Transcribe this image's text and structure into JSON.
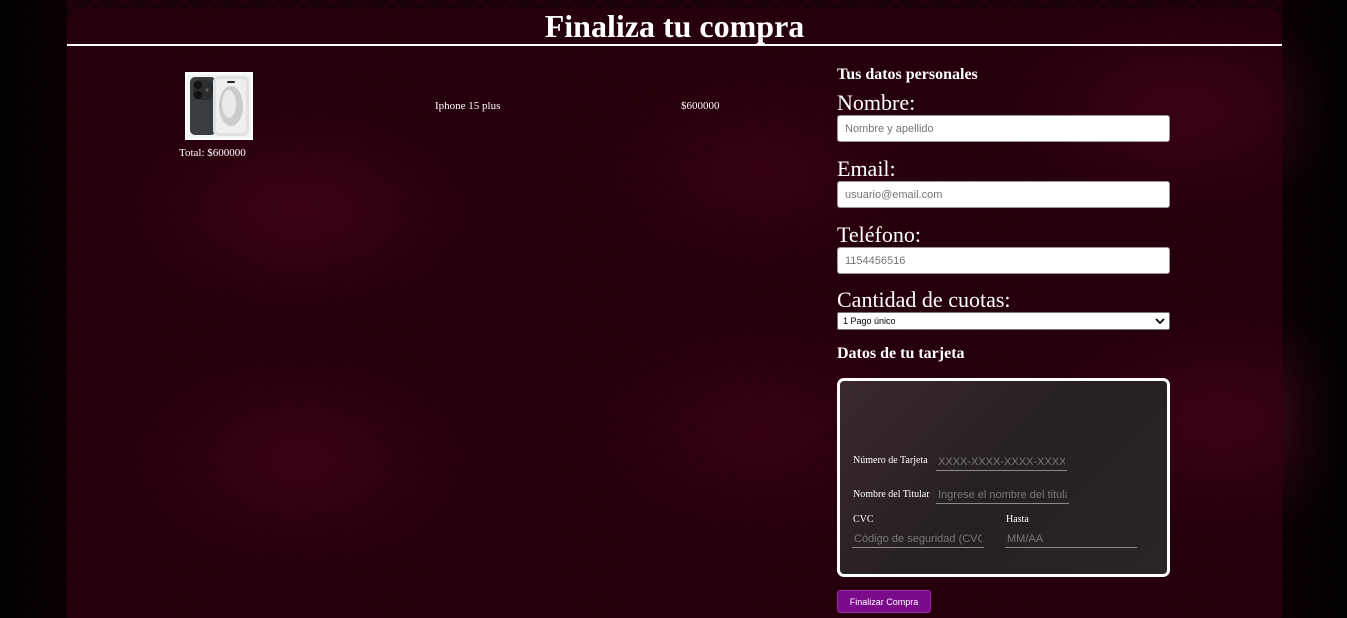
{
  "header": {
    "title": "Finaliza tu compra"
  },
  "cart": {
    "items": [
      {
        "name": "Iphone 15 plus",
        "price": "$600000",
        "image_icon": "iphone-product-image"
      }
    ],
    "total": "Total: $600000"
  },
  "form": {
    "personal_title": "Tus datos personales",
    "name_label": "Nombre:",
    "name_placeholder": "Nombre y apellido",
    "email_label": "Email:",
    "email_placeholder": "usuario@email.com",
    "phone_label": "Teléfono:",
    "phone_placeholder": "1154456516",
    "installments_label": "Cantidad de cuotas:",
    "installments_selected": "1 Pago único",
    "card_title": "Datos de tu tarjeta",
    "card": {
      "number_label": "Número de Tarjeta",
      "number_placeholder": "XXXX-XXXX-XXXX-XXXX",
      "holder_label": "Nombre del Titular",
      "holder_placeholder": "Ingrese el nombre del titular",
      "cvc_label": "CVC",
      "cvc_placeholder": "Código de seguridad (CVC)",
      "expiry_label": "Hasta",
      "expiry_placeholder": "MM/AA"
    },
    "submit_label": "Finalizar Compra"
  },
  "colors": {
    "panel": "#28000a",
    "accent_button": "#7a0a8a",
    "background_pattern": "#d7195f"
  }
}
